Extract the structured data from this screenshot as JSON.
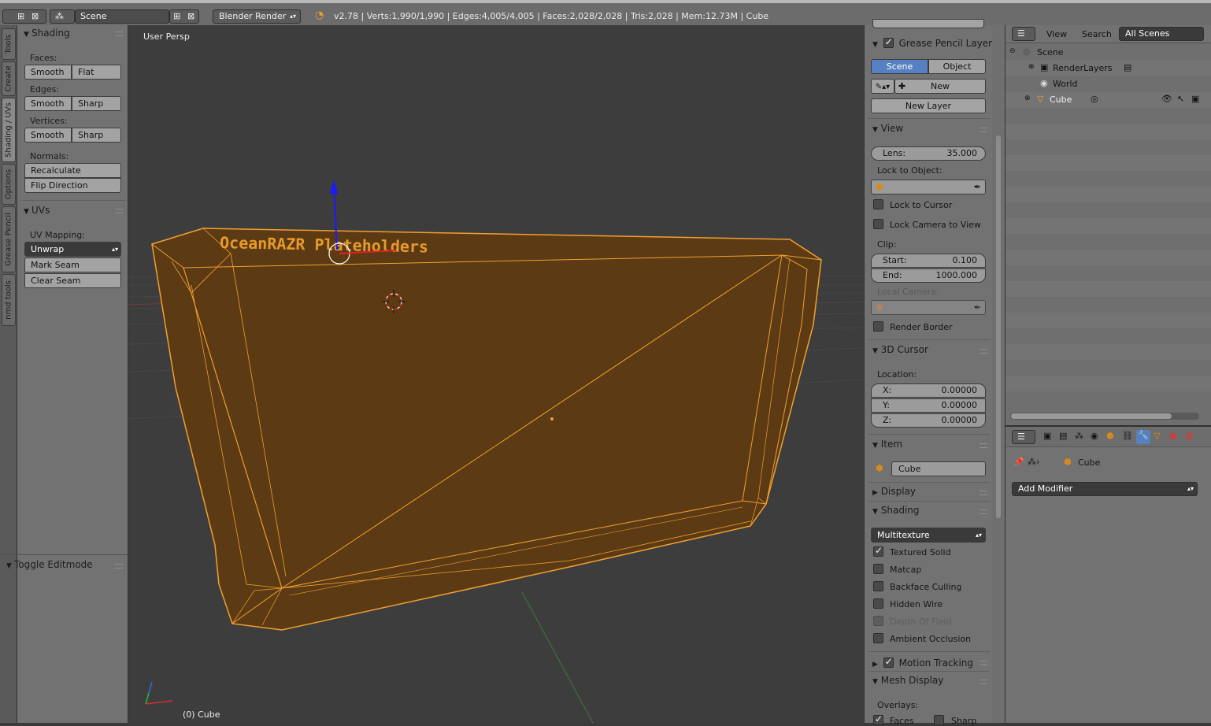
{
  "topbar": {
    "scene_label": "Scene",
    "render_engine": "Blender Render",
    "stats": "v2.78 | Verts:1,990/1,990 | Edges:4,005/4,005 | Faces:2,028/2,028 | Tris:2,028 | Mem:12.73M | Cube"
  },
  "vtabs": [
    "Tools",
    "Create",
    "Shading / UVs",
    "Options",
    "Grease Pencil",
    "nmd tools"
  ],
  "toolshelf": {
    "shading_title": "Shading",
    "faces_label": "Faces:",
    "edges_label": "Edges:",
    "vertices_label": "Vertices:",
    "normals_label": "Normals:",
    "smooth": "Smooth",
    "flat": "Flat",
    "sharp": "Sharp",
    "recalculate": "Recalculate",
    "flip_direction": "Flip Direction",
    "uvs_title": "UVs",
    "uv_mapping_label": "UV Mapping:",
    "unwrap": "Unwrap",
    "mark_seam": "Mark Seam",
    "clear_seam": "Clear Seam",
    "toggle_editmode": "Toggle Editmode"
  },
  "viewport": {
    "title": "User Persp",
    "object_label": "(0) Cube",
    "mesh_text": "OceanRAZR Plateholders",
    "mesh_color": "#f0a030"
  },
  "npanel": {
    "grease_title": "Grease Pencil Layers",
    "scene_tab": "Scene",
    "object_tab": "Object",
    "new": "New",
    "new_layer": "New Layer",
    "view_title": "View",
    "lens_label": "Lens:",
    "lens_value": "35.000",
    "lock_to_object": "Lock to Object:",
    "lock_to_cursor": "Lock to Cursor",
    "lock_camera": "Lock Camera to View",
    "clip_label": "Clip:",
    "start_label": "Start:",
    "start_value": "0.100",
    "end_label": "End:",
    "end_value": "1000.000",
    "local_camera": "Local Camera:",
    "render_border": "Render Border",
    "cursor_title": "3D Cursor",
    "location_label": "Location:",
    "x_label": "X:",
    "x_value": "0.00000",
    "y_label": "Y:",
    "y_value": "0.00000",
    "z_label": "Z:",
    "z_value": "0.00000",
    "item_title": "Item",
    "item_name": "Cube",
    "display_title": "Display",
    "shading_title": "Shading",
    "shading_mode": "Multitexture",
    "textured_solid": "Textured Solid",
    "matcap": "Matcap",
    "backface_culling": "Backface Culling",
    "hidden_wire": "Hidden Wire",
    "depth_of_field": "Depth Of Field",
    "ambient_occlusion": "Ambient Occlusion",
    "motion_tracking": "Motion Tracking",
    "mesh_display": "Mesh Display",
    "overlays": "Overlays:",
    "faces": "Faces",
    "sharp": "Sharp"
  },
  "outliner": {
    "view": "View",
    "search": "Search",
    "all_scenes": "All Scenes",
    "rows": [
      "Scene",
      "RenderLayers",
      "World",
      "Cube"
    ]
  },
  "properties": {
    "object_name": "Cube",
    "add_modifier": "Add Modifier"
  },
  "colors": {
    "accent_blue": "#5680c2",
    "selection_orange": "#f0a030"
  }
}
